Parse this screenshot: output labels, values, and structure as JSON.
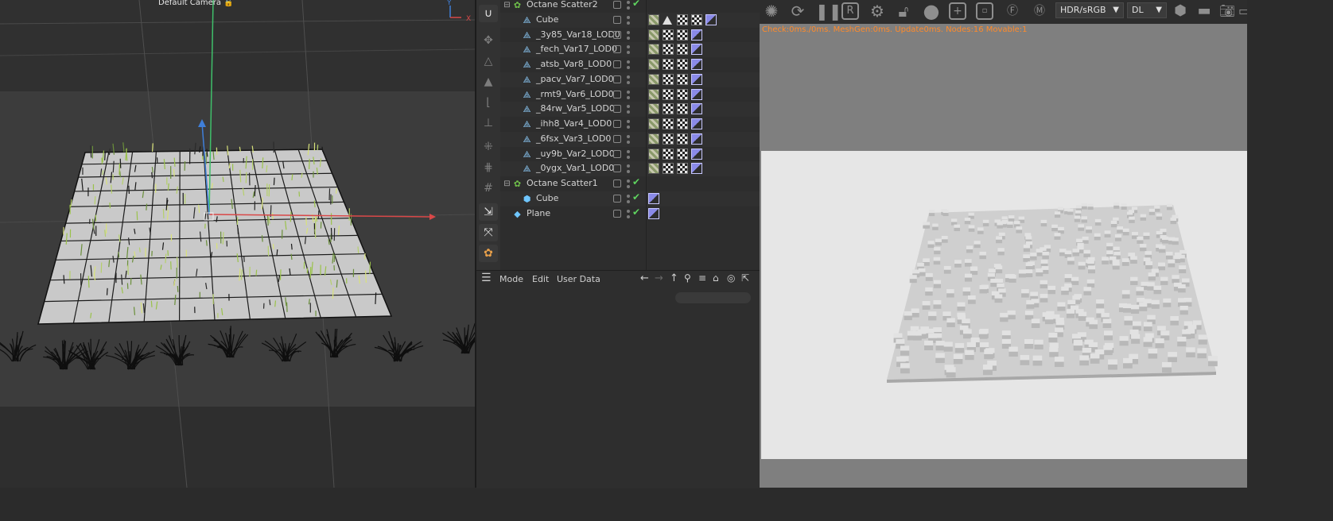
{
  "viewport": {
    "camera_label": "Default Camera",
    "axis_x": "X",
    "axis_y": "Y"
  },
  "toolbar": {
    "icons": [
      "magnet-icon",
      "move-axis-icon",
      "scale-axis-icon",
      "rotate-axis-icon",
      "snap-icon",
      "snap2-icon",
      "grid-snap-icon",
      "grid-icon",
      "hash-icon",
      "move-icon",
      "scale-icon",
      "rotate-icon"
    ]
  },
  "object_manager": {
    "rows": [
      {
        "name": "Octane Scatter2",
        "type": "scatter",
        "indent": 0,
        "expanded": true,
        "check": true
      },
      {
        "name": "Cube",
        "type": "mesh",
        "indent": 1
      },
      {
        "name": "_3y85_Var18_LOD0",
        "type": "mesh",
        "indent": 1
      },
      {
        "name": "_fech_Var17_LOD0",
        "type": "mesh",
        "indent": 1
      },
      {
        "name": "_atsb_Var8_LOD0",
        "type": "mesh",
        "indent": 1
      },
      {
        "name": "_pacv_Var7_LOD0",
        "type": "mesh",
        "indent": 1
      },
      {
        "name": "_rmt9_Var6_LOD0",
        "type": "mesh",
        "indent": 1
      },
      {
        "name": "_84rw_Var5_LOD0",
        "type": "mesh",
        "indent": 1
      },
      {
        "name": "_ihh8_Var4_LOD0",
        "type": "mesh",
        "indent": 1
      },
      {
        "name": "_6fsx_Var3_LOD0",
        "type": "mesh",
        "indent": 1
      },
      {
        "name": "_uy9b_Var2_LOD0",
        "type": "mesh",
        "indent": 1
      },
      {
        "name": "_0ygx_Var1_LOD0",
        "type": "mesh",
        "indent": 1
      },
      {
        "name": "Octane Scatter1",
        "type": "scatter",
        "indent": 0,
        "expanded": true,
        "check": true
      },
      {
        "name": "Cube",
        "type": "cube",
        "indent": 1,
        "check": true
      },
      {
        "name": "Plane",
        "type": "plane",
        "indent": 0,
        "check": true
      }
    ]
  },
  "attribute_manager": {
    "mode": "Mode",
    "edit": "Edit",
    "user_data": "User Data"
  },
  "render_window": {
    "color_space": "HDR/sRGB",
    "kernel": "DL",
    "status": "Check:0ms./0ms. MeshGen:0ms. Update0ms. Nodes:16 Movable:1"
  },
  "colors": {
    "status": "#ff8a2a",
    "check": "#5fd35f",
    "axis_x": "#d94848",
    "axis_y": "#3fbf6a",
    "axis_z": "#3f7fd9"
  }
}
